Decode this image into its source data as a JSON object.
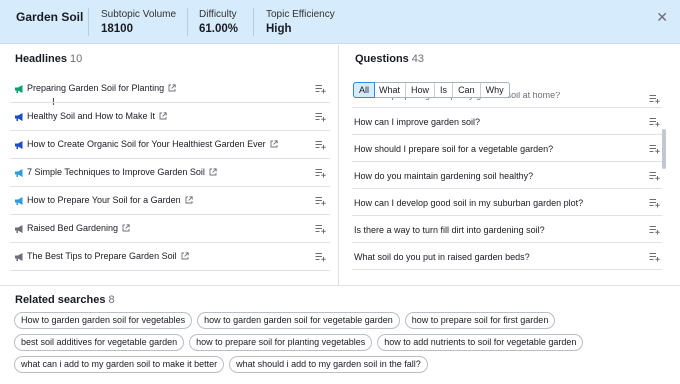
{
  "header": {
    "title": "Garden Soil",
    "stats": [
      {
        "label": "Subtopic Volume",
        "value": "18100"
      },
      {
        "label": "Difficulty",
        "value": "61.00%"
      },
      {
        "label": "Topic Efficiency",
        "value": "High"
      }
    ],
    "close_icon": "close-icon"
  },
  "headlines": {
    "title": "Headlines",
    "count": "10",
    "items": [
      {
        "text": "Preparing Garden Soil for Planting",
        "icon_color": "#00a36e"
      },
      {
        "text": "Healthy Soil and How to Make It",
        "icon_color": "#1a4ec7"
      },
      {
        "text": "How to Create Organic Soil for Your Healthiest Garden Ever",
        "icon_color": "#1a4ec7"
      },
      {
        "text": "7 Simple Techniques to Improve Garden Soil",
        "icon_color": "#2f9ce0"
      },
      {
        "text": "How to Prepare Your Soil for a Garden",
        "icon_color": "#2f9ce0"
      },
      {
        "text": "Raised Bed Gardening",
        "icon_color": "#6c6e79"
      },
      {
        "text": "The Best Tips to Prepare Garden Soil",
        "icon_color": "#6c6e79"
      }
    ]
  },
  "questions": {
    "title": "Questions",
    "count": "43",
    "filters": [
      "All",
      "What",
      "How",
      "Is",
      "Can",
      "Why"
    ],
    "active_filter": "All",
    "items": [
      "How do i prepare good quality garden soil at home?",
      "How can I improve garden soil?",
      "How should I prepare soil for a vegetable garden?",
      "How do you maintain gardening soil healthy?",
      "How can I develop good soil in my suburban garden plot?",
      "Is there a way to turn fill dirt into gardening soil?",
      "What soil do you put in raised garden beds?"
    ]
  },
  "related": {
    "title": "Related searches",
    "count": "8",
    "items": [
      "How to garden garden soil for vegetables",
      "how to garden garden soil for vegetable garden",
      "how to prepare soil for first garden",
      "best soil additives for vegetable garden",
      "how to prepare soil for planting vegetables",
      "how to add nutrients to soil for vegetable garden",
      "what can i add to my garden soil to make it better",
      "what should i add to my garden soil in the fall?"
    ]
  }
}
